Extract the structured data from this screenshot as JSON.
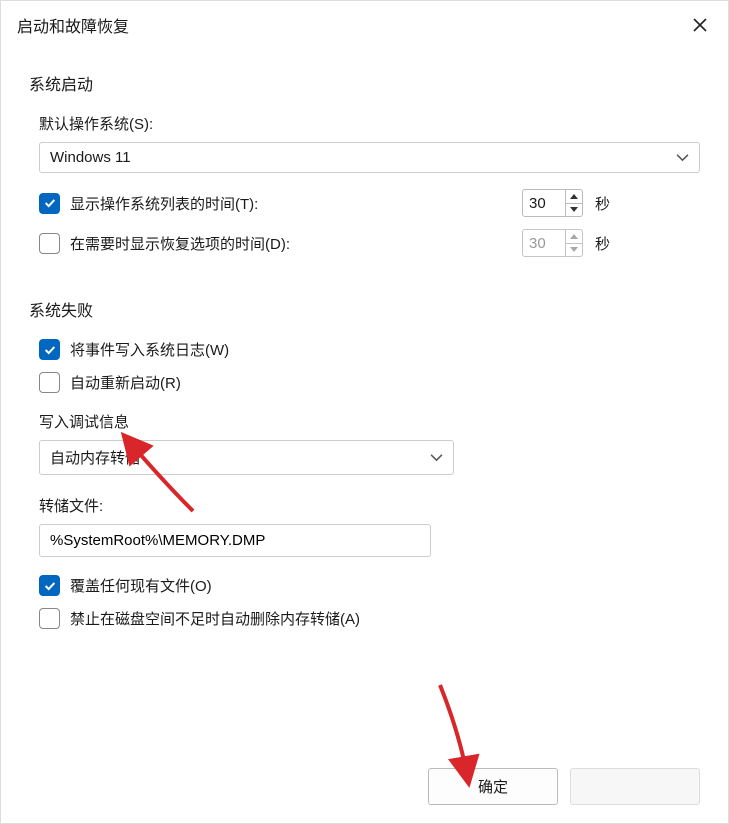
{
  "dialog": {
    "title": "启动和故障恢复"
  },
  "icons": {
    "close": "✕"
  },
  "startup": {
    "title": "系统启动",
    "defaultOS": {
      "label": "默认操作系统(S):",
      "value": "Windows 11"
    },
    "showList": {
      "label": "显示操作系统列表的时间(T):",
      "checked": true,
      "value": "30",
      "unit": "秒"
    },
    "showRecovery": {
      "label": "在需要时显示恢复选项的时间(D):",
      "checked": false,
      "value": "30",
      "unit": "秒"
    }
  },
  "sysfail": {
    "title": "系统失败",
    "writeEvent": {
      "label": "将事件写入系统日志(W)",
      "checked": true
    },
    "autoRestart": {
      "label": "自动重新启动(R)",
      "checked": false
    },
    "debugInfo": {
      "title": "写入调试信息",
      "select": "自动内存转储",
      "dumpFileLabel": "转储文件:",
      "dumpFile": "%SystemRoot%\\MEMORY.DMP",
      "overwrite": {
        "label": "覆盖任何现有文件(O)",
        "checked": true
      },
      "noLowDisk": {
        "label": "禁止在磁盘空间不足时自动删除内存转储(A)",
        "checked": false
      }
    }
  },
  "footer": {
    "ok": "确定",
    "cancel": ""
  },
  "annotations": {
    "arrow_color": "#d8262a"
  }
}
